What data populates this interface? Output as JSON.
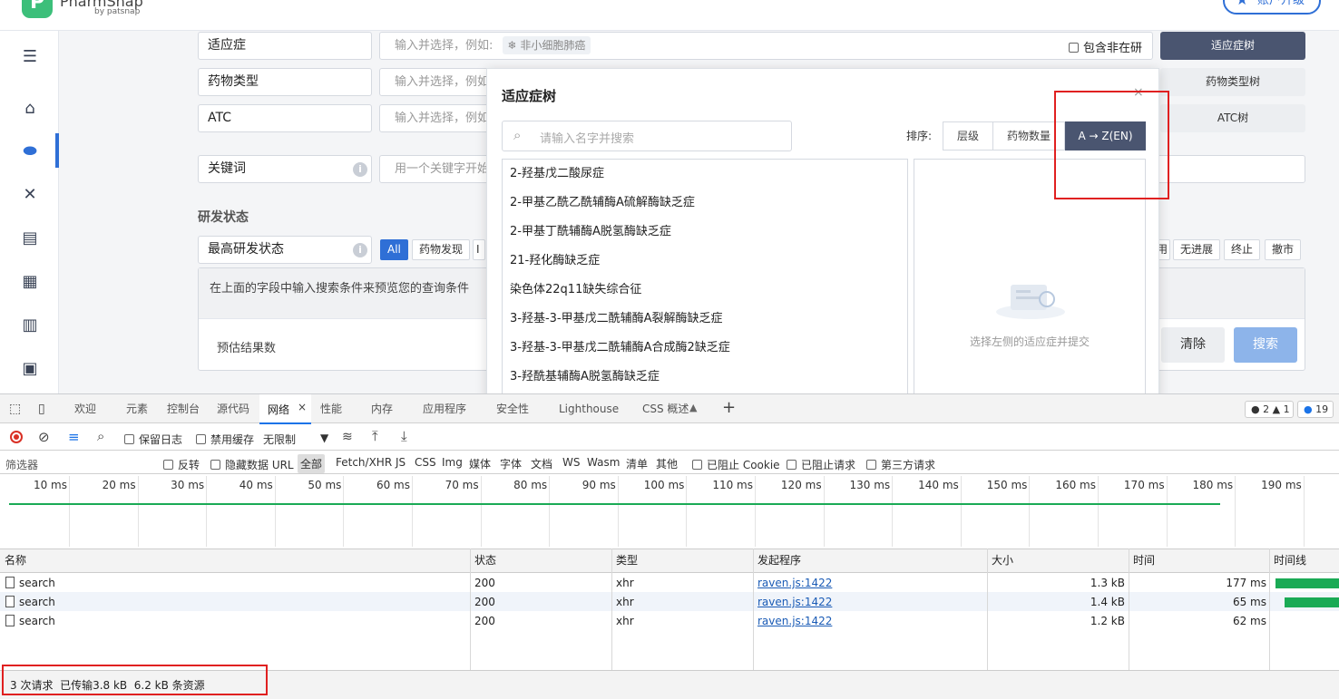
{
  "app": {
    "brand": "PharmSnap",
    "brand_sub": "by patsnap",
    "upgrade_label": "账户升级",
    "fields": [
      {
        "label": "适应症",
        "placeholder": "输入并选择，例如:",
        "example": "非小细胞肺癌",
        "checkbox_label": "包含非在研",
        "button": "适应症树"
      },
      {
        "label": "药物类型",
        "placeholder": "输入并选择，例如",
        "button": "药物类型树"
      },
      {
        "label": "ATC",
        "placeholder": "输入并选择，例如",
        "button": "ATC树"
      },
      {
        "label": "关键词",
        "placeholder": "用一个关键字开始"
      }
    ],
    "section_title": "研发状态",
    "status_label": "最高研发状态",
    "status_tags_left": [
      "All",
      "药物发现",
      "I"
    ],
    "status_tags_right": [
      "用",
      "无进展",
      "终止",
      "撤市"
    ],
    "preview_hint": "在上面的字段中输入搜索条件来预览您的查询条件",
    "estimate_label": "预估结果数",
    "clear_label": "清除",
    "search_label": "搜索"
  },
  "modal": {
    "title": "适应症树",
    "search_placeholder": "请输入名字并搜索",
    "sort_label": "排序:",
    "sort_options": [
      "层级",
      "药物数量",
      "A → Z(EN)"
    ],
    "items": [
      "2-羟基戊二酸尿症",
      "2-甲基乙酰乙酰辅酶A硫解酶缺乏症",
      "2-甲基丁酰辅酶A脱氢酶缺乏症",
      "21-羟化酶缺乏症",
      "染色体22q11缺失综合征",
      "3-羟基-3-甲基戊二酰辅酶A裂解酶缺乏症",
      "3-羟基-3-甲基戊二酰辅酶A合成酶2缺乏症",
      "3-羟酰基辅酶A脱氢酶缺乏症"
    ],
    "empty_text": "选择左侧的适应症并提交"
  },
  "devtools": {
    "tabs": [
      "欢迎",
      "元素",
      "控制台",
      "源代码",
      "网络",
      "性能",
      "内存",
      "应用程序",
      "安全性",
      "Lighthouse",
      "CSS 概述"
    ],
    "active_tab": "网络",
    "badges": {
      "errors": "2",
      "warnings": "1",
      "messages": "19"
    },
    "toolbar": {
      "preserve_log": "保留日志",
      "disable_cache": "禁用缓存",
      "throttle": "无限制"
    },
    "filter": {
      "placeholder": "筛选器",
      "invert": "反转",
      "hide_data_url": "隐藏数据 URL",
      "types": [
        "全部",
        "Fetch/XHR",
        "JS",
        "CSS",
        "Img",
        "媒体",
        "字体",
        "文档",
        "WS",
        "Wasm",
        "清单",
        "其他"
      ],
      "blocked_cookie": "已阻止 Cookie",
      "blocked_requests": "已阻止请求",
      "third_party": "第三方请求"
    },
    "timeline_ticks": [
      "10 ms",
      "20 ms",
      "30 ms",
      "40 ms",
      "50 ms",
      "60 ms",
      "70 ms",
      "80 ms",
      "90 ms",
      "100 ms",
      "110 ms",
      "120 ms",
      "130 ms",
      "140 ms",
      "150 ms",
      "160 ms",
      "170 ms",
      "180 ms",
      "190 ms"
    ],
    "columns": [
      "名称",
      "状态",
      "类型",
      "发起程序",
      "大小",
      "时间",
      "时间线"
    ],
    "rows": [
      {
        "name": "search",
        "status": "200",
        "type": "xhr",
        "initiator": "raven.js:1422",
        "size": "1.3 kB",
        "time": "177 ms"
      },
      {
        "name": "search",
        "status": "200",
        "type": "xhr",
        "initiator": "raven.js:1422",
        "size": "1.4 kB",
        "time": "65 ms"
      },
      {
        "name": "search",
        "status": "200",
        "type": "xhr",
        "initiator": "raven.js:1422",
        "size": "1.2 kB",
        "time": "62 ms"
      }
    ],
    "summary": "3 次请求  已传输3.8 kB  6.2 kB 条资源"
  },
  "colors": {
    "accent": "#2f6fd6",
    "dark_button": "#4a5570",
    "annotation": "#e02020",
    "waterfall": "#1aaa55"
  }
}
